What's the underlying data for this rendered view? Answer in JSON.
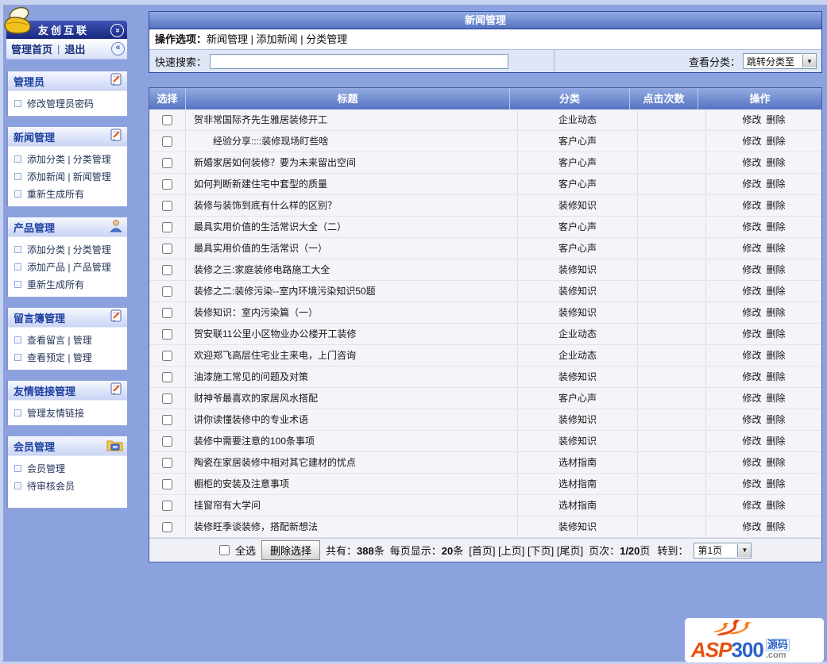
{
  "sidebar": {
    "brand": "友创互联",
    "home_link": "管理首页",
    "separator": "|",
    "exit_link": "退出",
    "collapse_top_icon": "chevron-double-down-icon",
    "collapse_icon": "chevron-double-left-icon",
    "sections": [
      {
        "title": "管理员",
        "icon": "clipboard-pen-icon",
        "items": [
          "修改管理员密码"
        ]
      },
      {
        "title": "新闻管理",
        "icon": "clipboard-pen-icon",
        "items": [
          "添加分类 | 分类管理",
          "添加新闻 | 新闻管理",
          "重新生成所有"
        ]
      },
      {
        "title": "产品管理",
        "icon": "user-icon",
        "items": [
          "添加分类 | 分类管理",
          "添加产品 | 产品管理",
          "重新生成所有"
        ]
      },
      {
        "title": "留言簿管理",
        "icon": "clipboard-pen-icon",
        "items": [
          "查看留言 | 管理",
          "查看预定 | 管理"
        ]
      },
      {
        "title": "友情链接管理",
        "icon": "clipboard-pen-icon",
        "items": [
          "管理友情链接"
        ]
      },
      {
        "title": "会员管理",
        "icon": "folder-icon",
        "items": [
          "会员管理",
          "待审核会员"
        ]
      }
    ]
  },
  "main": {
    "title": "新闻管理",
    "ops": {
      "label": "操作选项：",
      "separator": "|",
      "links": [
        "新闻管理",
        "添加新闻",
        "分类管理"
      ]
    },
    "search": {
      "label": "快速搜索：",
      "value": "",
      "placeholder": ""
    },
    "category_filter": {
      "label": "查看分类：",
      "selected": "跳转分类至"
    },
    "table": {
      "headers": [
        "选择",
        "标题",
        "分类",
        "点击次数",
        "操作"
      ],
      "edit_label": "修改",
      "delete_label": "删除",
      "rows": [
        {
          "title": "贺非常国际齐先生雅居装修开工",
          "category": "企业动态",
          "clicks": ""
        },
        {
          "title": "　　经验分享::::装修现场盯些啥",
          "category": "客户心声",
          "clicks": ""
        },
        {
          "title": "新婚家居如何装修？要为未来留出空间",
          "category": "客户心声",
          "clicks": ""
        },
        {
          "title": "如何判断新建住宅中套型的质量",
          "category": "客户心声",
          "clicks": ""
        },
        {
          "title": "装修与装饰到底有什么样的区别？",
          "category": "装修知识",
          "clicks": ""
        },
        {
          "title": "最具实用价值的生活常识大全（二）",
          "category": "客户心声",
          "clicks": ""
        },
        {
          "title": "最具实用价值的生活常识（一）",
          "category": "客户心声",
          "clicks": ""
        },
        {
          "title": "装修之三:家庭装修电路施工大全",
          "category": "装修知识",
          "clicks": ""
        },
        {
          "title": "装修之二:装修污染--室内环境污染知识50题",
          "category": "装修知识",
          "clicks": ""
        },
        {
          "title": "装修知识：室内污染篇（一）",
          "category": "装修知识",
          "clicks": ""
        },
        {
          "title": "贺安联11公里小区物业办公楼开工装修",
          "category": "企业动态",
          "clicks": ""
        },
        {
          "title": "欢迎郑飞高层住宅业主来电，上门咨询",
          "category": "企业动态",
          "clicks": ""
        },
        {
          "title": "油漆施工常见的问题及对策",
          "category": "装修知识",
          "clicks": ""
        },
        {
          "title": "财神爷最喜欢的家居风水搭配",
          "category": "客户心声",
          "clicks": ""
        },
        {
          "title": "讲你读懂装修中的专业术语",
          "category": "装修知识",
          "clicks": ""
        },
        {
          "title": "装修中需要注意的100条事项",
          "category": "装修知识",
          "clicks": ""
        },
        {
          "title": "陶瓷在家居装修中相对其它建材的忧点",
          "category": "选材指南",
          "clicks": ""
        },
        {
          "title": "橱柜的安装及注意事项",
          "category": "选材指南",
          "clicks": ""
        },
        {
          "title": "挂窗帘有大学问",
          "category": "选材指南",
          "clicks": ""
        },
        {
          "title": "装修旺季谈装修，搭配新想法",
          "category": "装修知识",
          "clicks": ""
        }
      ]
    },
    "footer": {
      "select_all": "全选",
      "delete_button": "删除选择",
      "total_label": "共有：",
      "total_count": "388",
      "total_unit": "条",
      "per_page_label": "每页显示：",
      "per_page_count": "20",
      "per_page_unit": "条",
      "nav_links": [
        "[首页]",
        "[上页]",
        "[下页]",
        "[尾页]"
      ],
      "page_label": "页次：",
      "page_value": "1/20",
      "page_unit": "页",
      "goto_label": "转到：",
      "goto_selected": "第1页"
    }
  },
  "watermark": {
    "asp": "ASP",
    "num": "300",
    "cn": "源码",
    "com": ".com"
  }
}
